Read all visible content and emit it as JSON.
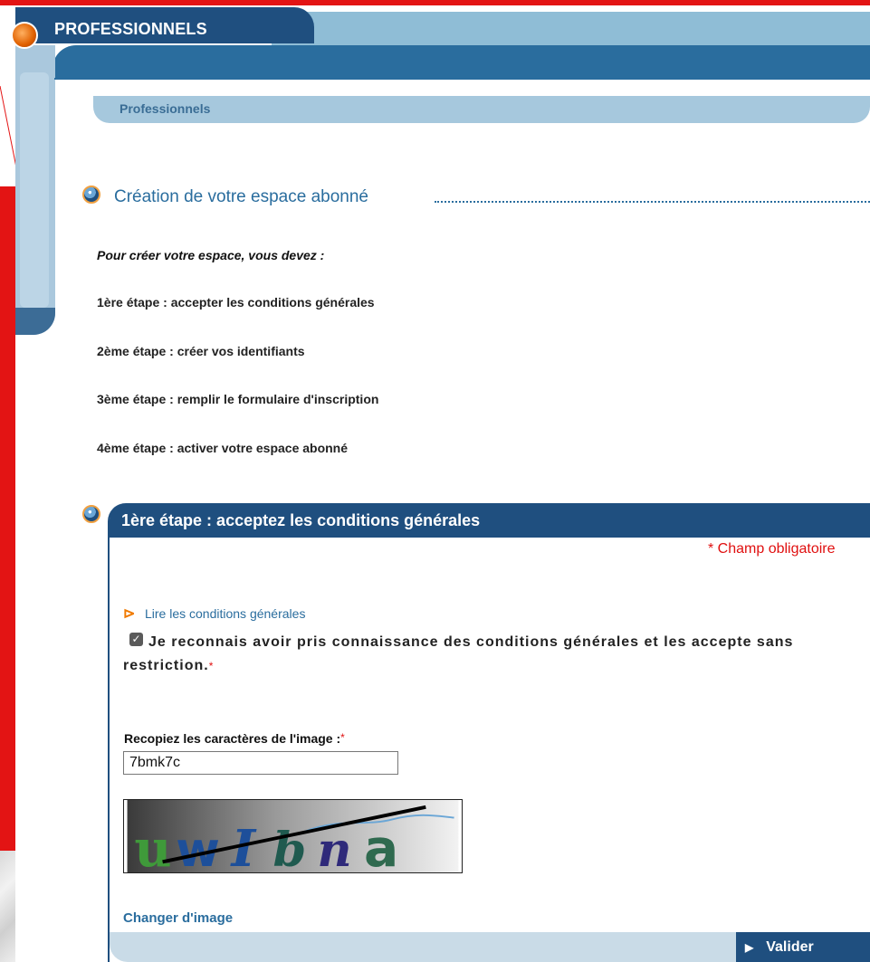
{
  "header": {
    "title": "PROFESSIONNELS"
  },
  "breadcrumb": {
    "label": "Professionnels"
  },
  "section": {
    "title": "Création de votre espace abonné",
    "intro": "Pour créer votre espace, vous devez :",
    "steps": [
      "1ère étape : accepter les conditions générales",
      "2ème étape : créer vos identifiants",
      "3ème étape : remplir le formulaire d'inscription",
      "4ème étape : activer votre espace abonné"
    ]
  },
  "panel": {
    "title": "1ère étape : acceptez les conditions générales",
    "required_note": "* Champ obligatoire",
    "conditions_link": "Lire les conditions générales",
    "accept_label": "Je reconnais avoir pris connaissance des conditions générales et les accepte sans restriction.",
    "accept_checked": true,
    "captcha_label": "Recopiez les caractères de l'image :",
    "captcha_value": "7bmk7c",
    "captcha_image_text": "uwIbna",
    "change_image_link": "Changer d'image",
    "submit_label": "Valider",
    "required_marker": "*"
  },
  "colors": {
    "brand_dark": "#1f4f7f",
    "brand_mid": "#2a6d9e",
    "brand_light": "#a6c8dd",
    "frame_red": "#e31414",
    "required_red": "#e01010",
    "link_orange": "#f07a00"
  }
}
